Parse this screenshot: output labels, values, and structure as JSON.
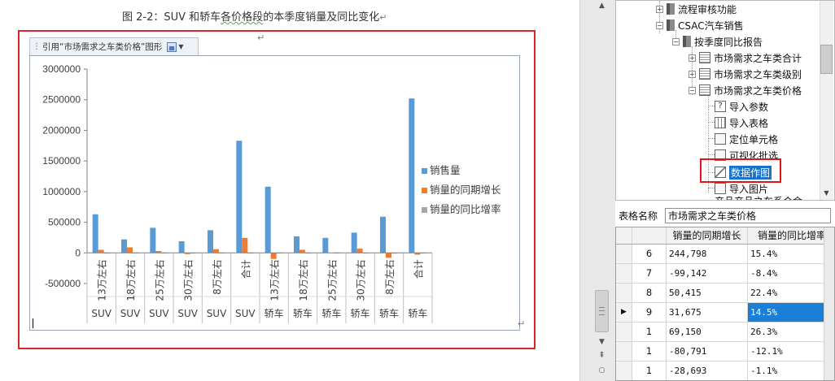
{
  "document": {
    "caption": "图 2-2：SUV 和轿车各价格段的本季度销量及同比变化",
    "caption_parts": {
      "pre": "图 2-2：SUV 和轿车",
      "squiggle": "各价格段",
      "post": "的本季度销量及同比变化"
    },
    "paragraph_mark": "↵",
    "chart_tab_label": "引用“市场需求之车类价格”图形"
  },
  "chart_data": {
    "type": "bar",
    "categories": [
      {
        "price": "13万左右",
        "car": "SUV"
      },
      {
        "price": "18万左右",
        "car": "SUV"
      },
      {
        "price": "25万左右",
        "car": "SUV"
      },
      {
        "price": "30万左右",
        "car": "SUV"
      },
      {
        "price": "8万左右",
        "car": "SUV"
      },
      {
        "price": "合计",
        "car": "SUV"
      },
      {
        "price": "13万左右",
        "car": "轿车"
      },
      {
        "price": "18万左右",
        "car": "轿车"
      },
      {
        "price": "25万左右",
        "car": "轿车"
      },
      {
        "price": "30万左右",
        "car": "轿车"
      },
      {
        "price": "8万左右",
        "car": "轿车"
      },
      {
        "price": "合计",
        "car": "轿车"
      }
    ],
    "series": [
      {
        "name": "销售量",
        "color": "#5b9bd5",
        "values": [
          630000,
          220000,
          410000,
          190000,
          370000,
          1830000,
          1080000,
          270000,
          245000,
          330000,
          590000,
          2520000
        ]
      },
      {
        "name": "销量的同期增长",
        "color": "#ed7d31",
        "values": [
          50000,
          90000,
          30000,
          -20000,
          60000,
          245000,
          -99000,
          50000,
          0,
          69000,
          -81000,
          -29000
        ]
      },
      {
        "name": "销量的同比增率",
        "color": "#a5a5a5",
        "values": [
          0.15,
          0.26,
          0.08,
          -0.1,
          0.2,
          0.15,
          -0.08,
          0.22,
          0.15,
          0.26,
          -0.12,
          -0.01
        ]
      }
    ],
    "ylim": [
      -500000,
      3000000
    ],
    "yticks": [
      "3000000",
      "2500000",
      "2000000",
      "1500000",
      "1000000",
      "500000",
      "0",
      "-500000"
    ],
    "ytick_values": [
      3000000,
      2500000,
      2000000,
      1500000,
      1000000,
      500000,
      0,
      -500000
    ],
    "legend_position": "right",
    "grid": false
  },
  "tree": {
    "nodes": [
      {
        "label": "流程审核功能",
        "icon": "folder-icon"
      },
      {
        "label": "CSAC汽车销售",
        "icon": "folder-icon"
      },
      {
        "label": "按季度同比报告",
        "icon": "folder-icon"
      },
      {
        "label": "市场需求之车类合计",
        "icon": "report-icon"
      },
      {
        "label": "市场需求之车类级别",
        "icon": "report-icon"
      },
      {
        "label": "市场需求之车类价格",
        "icon": "report-icon"
      },
      {
        "label": "导入参数",
        "icon": "question-icon"
      },
      {
        "label": "导入表格",
        "icon": "table-icon"
      },
      {
        "label": "定位单元格",
        "icon": "document-icon"
      },
      {
        "label": "可视化批选",
        "icon": "filter-icon"
      },
      {
        "label": "数据作图",
        "icon": "chart-icon"
      },
      {
        "label": "导入图片",
        "icon": "image-icon"
      },
      {
        "label": "产品产品之车系合金",
        "icon": "report-icon"
      }
    ]
  },
  "table_name": {
    "label": "表格名称",
    "value": "市场需求之车类价格"
  },
  "grid": {
    "headers": [
      "",
      "",
      "销量的同期增长",
      "销量的同比增率"
    ],
    "rows": [
      {
        "marker": "",
        "idx": "6",
        "growth": "244,798",
        "rate": "15.4%"
      },
      {
        "marker": "",
        "idx": "7",
        "growth": "-99,142",
        "rate": "-8.4%"
      },
      {
        "marker": "",
        "idx": "8",
        "growth": "50,415",
        "rate": "22.4%"
      },
      {
        "marker": "▶",
        "idx": "9",
        "growth": "31,675",
        "rate": "14.5%"
      },
      {
        "marker": "",
        "idx": "1",
        "growth": "69,150",
        "rate": "26.3%"
      },
      {
        "marker": "",
        "idx": "1",
        "growth": "-80,791",
        "rate": "-12.1%"
      },
      {
        "marker": "",
        "idx": "1",
        "growth": "-28,693",
        "rate": "-1.1%"
      }
    ]
  }
}
